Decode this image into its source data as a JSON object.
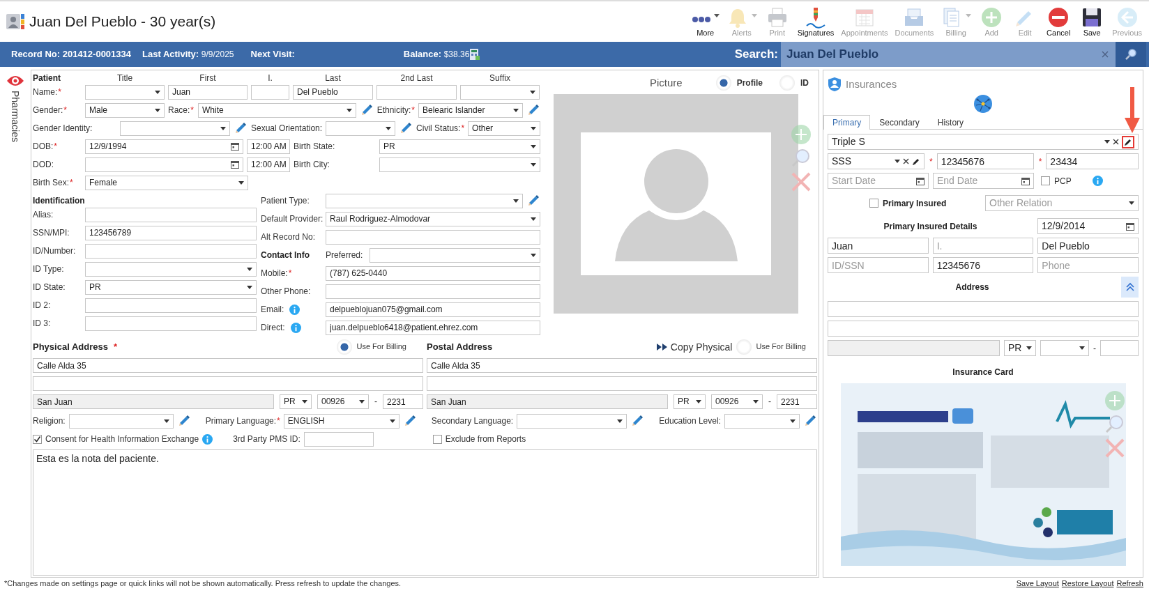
{
  "header": {
    "title": "Juan Del Pueblo - 30 year(s)"
  },
  "toolbar": [
    {
      "label": "More",
      "kind": "more",
      "disabled": false,
      "dropdown": true
    },
    {
      "label": "Alerts",
      "kind": "bell",
      "disabled": true,
      "dropdown": true
    },
    {
      "label": "Print",
      "kind": "print",
      "disabled": true,
      "dropdown": false
    },
    {
      "label": "Signatures",
      "kind": "signature",
      "disabled": false,
      "dropdown": false
    },
    {
      "label": "Appointments",
      "kind": "calendar",
      "disabled": true,
      "dropdown": false
    },
    {
      "label": "Documents",
      "kind": "documents",
      "disabled": true,
      "dropdown": false
    },
    {
      "label": "Billing",
      "kind": "billing",
      "disabled": true,
      "dropdown": true
    },
    {
      "label": "Add",
      "kind": "add",
      "disabled": true,
      "dropdown": false
    },
    {
      "label": "Edit",
      "kind": "edit",
      "disabled": true,
      "dropdown": false
    },
    {
      "label": "Cancel",
      "kind": "cancel",
      "disabled": false,
      "dropdown": false
    },
    {
      "label": "Save",
      "kind": "save",
      "disabled": false,
      "dropdown": false
    },
    {
      "label": "Previous",
      "kind": "previous",
      "disabled": true,
      "dropdown": false
    }
  ],
  "info_bar": {
    "record_label": "Record No:",
    "record_no": "201412-0001334",
    "activity_label": "Last Activity:",
    "last_activity": "9/9/2025",
    "next_visit_label": "Next Visit:",
    "balance_label": "Balance:",
    "balance": "$38.36",
    "search_label": "Search:",
    "search": "Juan Del Pueblo"
  },
  "side_tab": {
    "label": "Pharmacies"
  },
  "patient": {
    "heading": "Patient",
    "name_columns": [
      "Title",
      "First",
      "I.",
      "Last",
      "2nd Last",
      "Suffix"
    ],
    "name": {
      "label": "Name:",
      "required_mark": "*",
      "first": "Juan",
      "last": "Del Pueblo"
    },
    "gender": {
      "label": "Gender:",
      "required_mark": "*",
      "value": "Male"
    },
    "race": {
      "label": "Race:",
      "required_mark": "*",
      "value": "White"
    },
    "ethnicity": {
      "label": "Ethnicity:",
      "required_mark": "*",
      "value": "Belearic Islander"
    },
    "gender_identity": {
      "label": "Gender Identity:"
    },
    "sexual_orientation": {
      "label": "Sexual Orientation:"
    },
    "civil_status": {
      "label": "Civil Status:",
      "required_mark": "*",
      "value": "Other"
    },
    "dob": {
      "label": "DOB:",
      "required_mark": "*",
      "value": "12/9/1994",
      "time": "12:00 AM"
    },
    "dod": {
      "label": "DOD:",
      "time": "12:00 AM"
    },
    "birth_state": {
      "label": "Birth State:",
      "value": "PR"
    },
    "birth_city": {
      "label": "Birth City:"
    },
    "birth_sex": {
      "label": "Birth Sex:",
      "required_mark": "*",
      "value": "Female"
    }
  },
  "identification": {
    "heading": "Identification",
    "alias": {
      "label": "Alias:"
    },
    "ssn_mpi": {
      "label": "SSN/MPI:",
      "value": "123456789"
    },
    "id_number": {
      "label": "ID/Number:"
    },
    "id_type": {
      "label": "ID Type:"
    },
    "id_state": {
      "label": "ID State:",
      "value": "PR"
    },
    "id_2": {
      "label": "ID 2:"
    },
    "id_3": {
      "label": "ID 3:"
    }
  },
  "details": {
    "patient_type": {
      "label": "Patient Type:"
    },
    "default_provider": {
      "label": "Default Provider:",
      "value": "Raul Rodriguez-Almodovar"
    },
    "alt_record_no": {
      "label": "Alt Record No:"
    },
    "contact_heading": "Contact Info",
    "preferred": {
      "label": "Preferred:"
    },
    "mobile": {
      "label": "Mobile:",
      "required_mark": "*",
      "value": "(787) 625-0440"
    },
    "other_phone": {
      "label": "Other Phone:"
    },
    "email": {
      "label": "Email:",
      "value": "delpueblojuan075@gmail.com"
    },
    "direct": {
      "label": "Direct:",
      "value": "juan.delpueblo6418@patient.ehrez.com"
    }
  },
  "picture": {
    "title": "Picture",
    "options": [
      {
        "label": "Profile",
        "selected": true
      },
      {
        "label": "ID",
        "selected": false
      }
    ]
  },
  "physical_address": {
    "title": "Physical Address",
    "required_mark": "*",
    "billing": {
      "label": "Use For Billing",
      "selected": true
    },
    "street": "Calle Alda 35",
    "city": "San Juan",
    "state": "PR",
    "zip": "00926",
    "separator": "-",
    "zip_ext": "2231"
  },
  "postal_address": {
    "title": "Postal Address",
    "copy_label": "Copy Physical",
    "billing": {
      "label": "Use For Billing",
      "selected": false
    },
    "street": "Calle Alda 35",
    "city": "San Juan",
    "state": "PR",
    "zip": "00926",
    "separator": "-",
    "zip_ext": "2231"
  },
  "other": {
    "religion": {
      "label": "Religion:"
    },
    "primary_language": {
      "label": "Primary Language:",
      "required_mark": "*",
      "value": "ENGLISH"
    },
    "secondary_language": {
      "label": "Secondary Language:"
    },
    "education_level": {
      "label": "Education Level:"
    },
    "consent": {
      "label": "Consent for Health Information Exchange",
      "checked": true
    },
    "pms_id": {
      "label": "3rd Party PMS ID:"
    },
    "exclude": {
      "label": "Exclude from Reports",
      "checked": false
    }
  },
  "notes": "Esta es la nota del paciente.",
  "insurance": {
    "title": "Insurances",
    "tabs": [
      {
        "label": "Primary",
        "selected": true
      },
      {
        "label": "Secondary",
        "selected": false
      },
      {
        "label": "History",
        "selected": false
      }
    ],
    "plan": "Triple S",
    "plan_type": "SSS",
    "policy_mark": "*",
    "policy_no": "12345676",
    "group_mark": "*",
    "group_no": "23434",
    "start_date": {
      "placeholder": "Start Date"
    },
    "end_date": {
      "placeholder": "End Date"
    },
    "pcp": {
      "label": "PCP",
      "checked": false
    },
    "primary_insured": {
      "label": "Primary Insured",
      "checked": false
    },
    "relation": {
      "placeholder": "Other Relation"
    },
    "details_title": "Primary Insured Details",
    "birth_date": "12/9/2014",
    "first": "Juan",
    "initial": {
      "placeholder": "I."
    },
    "last": "Del Pueblo",
    "id_ssn": {
      "placeholder": "ID/SSN"
    },
    "insured_id": "12345676",
    "phone": {
      "placeholder": "Phone"
    },
    "address_title": "Address",
    "state": "PR",
    "separator": "-",
    "card_title": "Insurance Card"
  },
  "footer": {
    "note": "*Changes made on settings page or quick links will not be shown automatically. Press refresh to update the changes.",
    "links": [
      "Save Layout",
      "Restore Layout",
      "Refresh"
    ]
  }
}
